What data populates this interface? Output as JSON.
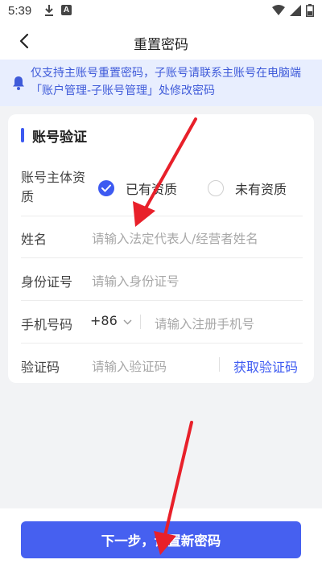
{
  "status_bar": {
    "time": "5:39",
    "a_badge": "A"
  },
  "header": {
    "title": "重置密码"
  },
  "notice": {
    "text": "仅支持主账号重置密码，子账号请联系主账号在电脑端「账户管理-子账号管理」处修改密码"
  },
  "section": {
    "title": "账号验证"
  },
  "form": {
    "subject_label": "账号主体资质",
    "option_has": "已有资质",
    "option_none": "未有资质",
    "selected_option": "已有资质",
    "name_label": "姓名",
    "name_placeholder": "请输入法定代表人/经营者姓名",
    "id_label": "身份证号",
    "id_placeholder": "请输入身份证号",
    "phone_label": "手机号码",
    "country_code": "+86",
    "phone_placeholder": "请输入注册手机号",
    "code_label": "验证码",
    "code_placeholder": "请输入验证码",
    "get_code": "获取验证码"
  },
  "footer": {
    "next_button": "下一步，设置新密码"
  },
  "colors": {
    "accent": "#3d5af1",
    "notice_bg": "#e8eefe",
    "annotation": "#e8202a"
  }
}
